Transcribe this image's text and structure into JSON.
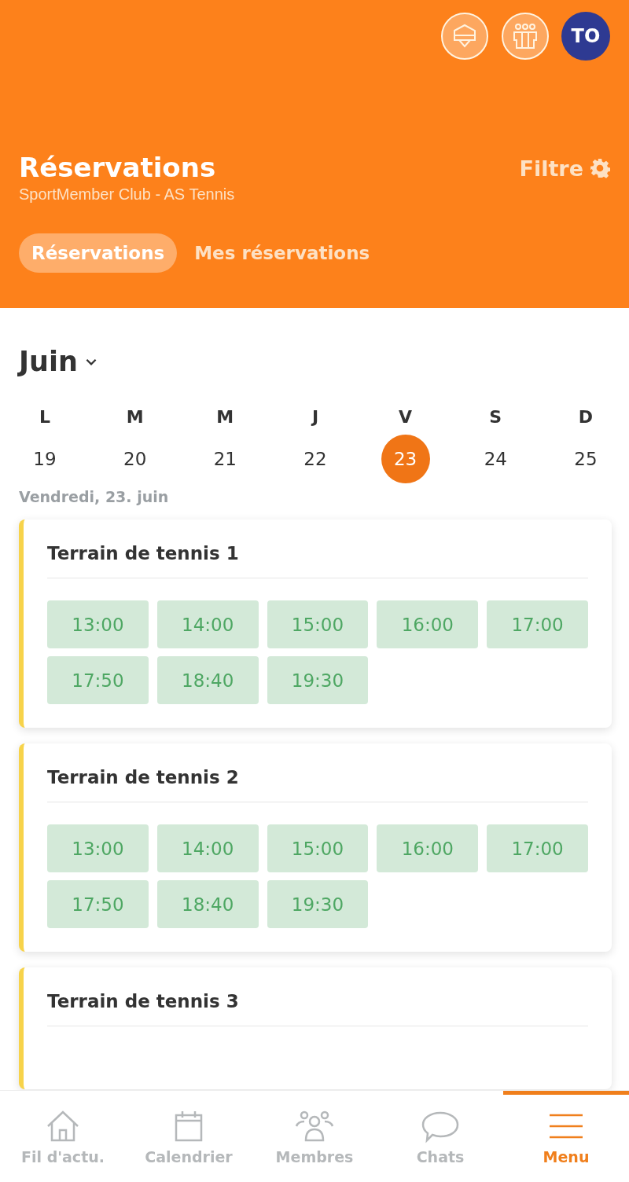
{
  "header_actions": [
    {
      "kind": "shield"
    },
    {
      "kind": "group"
    },
    {
      "kind": "avatar",
      "initials": "TO"
    }
  ],
  "title": "Réservations",
  "subtitle": "SportMember Club - AS Tennis",
  "filter": {
    "label": "Filtre"
  },
  "tabs": [
    {
      "label": "Réservations",
      "selected": true
    },
    {
      "label": "Mes réservations",
      "selected": false
    }
  ],
  "month": "Juin",
  "days": [
    {
      "weekday": "L",
      "date": "19",
      "selected": false
    },
    {
      "weekday": "M",
      "date": "20",
      "selected": false
    },
    {
      "weekday": "M",
      "date": "21",
      "selected": false
    },
    {
      "weekday": "J",
      "date": "22",
      "selected": false
    },
    {
      "weekday": "V",
      "date": "23",
      "selected": true
    },
    {
      "weekday": "S",
      "date": "24",
      "selected": false
    },
    {
      "weekday": "D",
      "date": "25",
      "selected": false
    }
  ],
  "date_label": "Vendredi, 23. juin",
  "courts": [
    {
      "name": "Terrain de tennis 1",
      "slots": [
        "13:00",
        "14:00",
        "15:00",
        "16:00",
        "17:00",
        "17:50",
        "18:40",
        "19:30"
      ]
    },
    {
      "name": "Terrain de tennis 2",
      "slots": [
        "13:00",
        "14:00",
        "15:00",
        "16:00",
        "17:00",
        "17:50",
        "18:40",
        "19:30"
      ]
    },
    {
      "name": "Terrain de tennis 3"
    }
  ],
  "nav": [
    {
      "kind": "home",
      "label": "Fil d'actu.",
      "selected": false
    },
    {
      "kind": "calendar",
      "label": "Calendrier",
      "selected": false
    },
    {
      "kind": "members",
      "label": "Membres",
      "selected": false
    },
    {
      "kind": "chat",
      "label": "Chats",
      "selected": false
    },
    {
      "kind": "menu",
      "label": "Menu",
      "selected": true
    }
  ]
}
